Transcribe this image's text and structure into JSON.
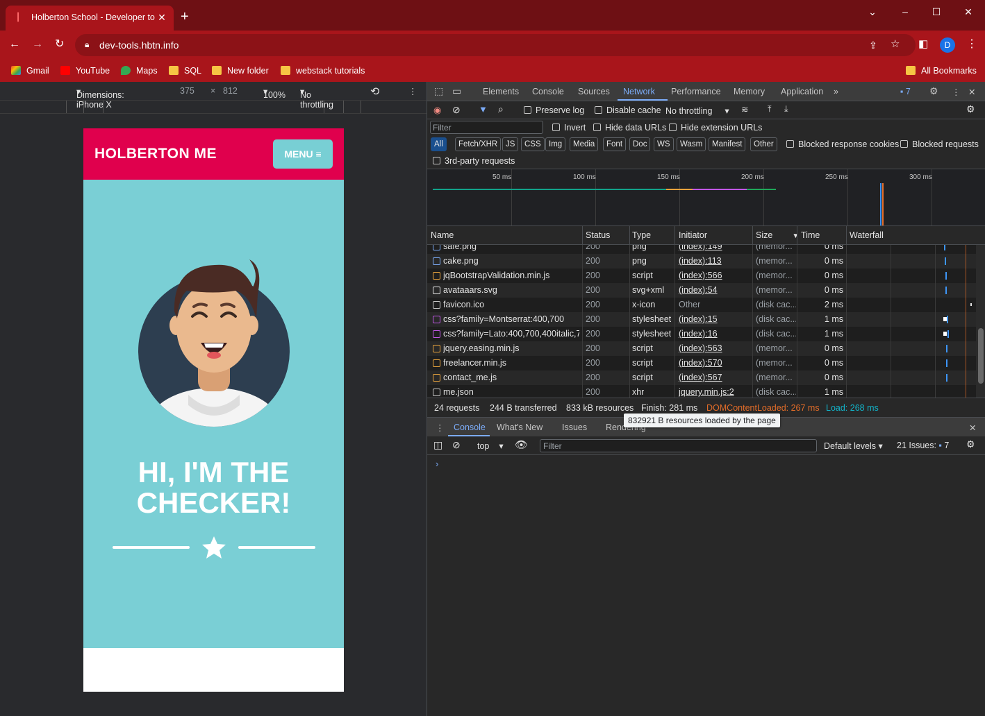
{
  "browser": {
    "tab_title": "Holberton School - Developer to",
    "url": "dev-tools.hbtn.info",
    "avatar_letter": "D",
    "accent_color": "#a9151b",
    "bookmarks": [
      "Gmail",
      "YouTube",
      "Maps",
      "SQL",
      "New folder",
      "webstack tutorials"
    ],
    "all_bookmarks": "All Bookmarks"
  },
  "device_toolbar": {
    "dimensions": "Dimensions: iPhone X",
    "width": "375",
    "times": "×",
    "height": "812",
    "zoom": "100%",
    "throttle": "No throttling"
  },
  "site": {
    "brand": "HOLBERTON ME",
    "menu": "MENU ≡",
    "hero_line1": "HI, I'M THE",
    "hero_line2": "CHECKER!",
    "nav_color": "#e0004d",
    "hero_color": "#7acfd5"
  },
  "devtools": {
    "tabs": [
      "Elements",
      "Console",
      "Sources",
      "Network",
      "Performance",
      "Memory",
      "Application"
    ],
    "issues_badge": "7",
    "toolbar": {
      "preserve_log": "Preserve log",
      "disable_cache": "Disable cache",
      "throttle": "No throttling"
    },
    "filter": {
      "placeholder": "Filter",
      "invert": "Invert",
      "hide_data": "Hide data URLs",
      "hide_ext": "Hide extension URLs",
      "chips": [
        "All",
        "Fetch/XHR",
        "JS",
        "CSS",
        "Img",
        "Media",
        "Font",
        "Doc",
        "WS",
        "Wasm",
        "Manifest",
        "Other"
      ],
      "blocked_cookies": "Blocked response cookies",
      "blocked_requests": "Blocked requests",
      "third_party": "3rd-party requests"
    },
    "overview_ticks": [
      "50 ms",
      "100 ms",
      "150 ms",
      "200 ms",
      "250 ms",
      "300 ms"
    ],
    "columns": [
      "Name",
      "Status",
      "Type",
      "Initiator",
      "Size",
      "Time",
      "Waterfall"
    ],
    "rows": [
      {
        "name": "safe.png",
        "status": "200",
        "type": "png",
        "initiator": "(index):149",
        "size": "(memor...",
        "time": "0 ms"
      },
      {
        "name": "cake.png",
        "status": "200",
        "type": "png",
        "initiator": "(index):113",
        "size": "(memor...",
        "time": "0 ms"
      },
      {
        "name": "jqBootstrapValidation.min.js",
        "status": "200",
        "type": "script",
        "initiator": "(index):566",
        "size": "(memor...",
        "time": "0 ms"
      },
      {
        "name": "avataaars.svg",
        "status": "200",
        "type": "svg+xml",
        "initiator": "(index):54",
        "size": "(memor...",
        "time": "0 ms"
      },
      {
        "name": "favicon.ico",
        "status": "200",
        "type": "x-icon",
        "initiator": "Other",
        "size": "(disk cac...",
        "time": "2 ms"
      },
      {
        "name": "css?family=Montserrat:400,700",
        "status": "200",
        "type": "stylesheet",
        "initiator": "(index):15",
        "size": "(disk cac...",
        "time": "1 ms"
      },
      {
        "name": "css?family=Lato:400,700,400italic,7...",
        "status": "200",
        "type": "stylesheet",
        "initiator": "(index):16",
        "size": "(disk cac...",
        "time": "1 ms"
      },
      {
        "name": "jquery.easing.min.js",
        "status": "200",
        "type": "script",
        "initiator": "(index):563",
        "size": "(memor...",
        "time": "0 ms"
      },
      {
        "name": "freelancer.min.js",
        "status": "200",
        "type": "script",
        "initiator": "(index):570",
        "size": "(memor...",
        "time": "0 ms"
      },
      {
        "name": "contact_me.js",
        "status": "200",
        "type": "script",
        "initiator": "(index):567",
        "size": "(memor...",
        "time": "0 ms"
      },
      {
        "name": "me.json",
        "status": "200",
        "type": "xhr",
        "initiator": "jquery.min.js:2",
        "size": "(disk cac...",
        "time": "1 ms"
      }
    ],
    "summary": {
      "requests": "24 requests",
      "transferred": "244 B transferred",
      "resources": "833 kB resources",
      "finish": "Finish: 281 ms",
      "dom": "DOMContentLoaded: 267 ms",
      "load": "Load: 268 ms"
    },
    "tooltip": "832921 B resources loaded by the page",
    "drawer_tabs": [
      "Console",
      "What's New",
      "Issues",
      "Rendering"
    ],
    "console": {
      "context": "top",
      "filter_placeholder": "Filter",
      "levels": "Default levels",
      "issues": "21 Issues:",
      "issues_count": "7"
    }
  }
}
